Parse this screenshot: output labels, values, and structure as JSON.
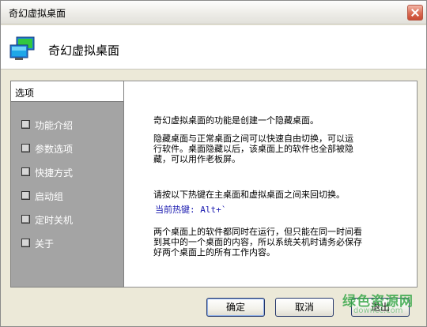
{
  "window": {
    "title": "奇幻虚拟桌面"
  },
  "header": {
    "title": "奇幻虚拟桌面",
    "icon": "two-monitors-icon"
  },
  "sidebar": {
    "heading": "选项",
    "items": [
      {
        "label": "功能介绍"
      },
      {
        "label": "参数选项"
      },
      {
        "label": "快捷方式"
      },
      {
        "label": "启动组"
      },
      {
        "label": "定时关机"
      },
      {
        "label": "关于"
      }
    ]
  },
  "content": {
    "intro": "奇幻虚拟桌面的功能是创建一个隐藏桌面。",
    "desc_lines": [
      "隐藏桌面与正常桌面之间可以快速自由切换，可以运",
      "行软件。桌面隐藏以后，该桌面上的软件也全部被隐",
      "藏，可以用作老板屏。"
    ],
    "hotkey_hint": "请按以下热键在主桌面和虚拟桌面之间来回切换。",
    "hotkey_value": "当前热键: Alt+`",
    "note_lines": [
      "两个桌面上的软件都同时在运行，但只能在同一时间看",
      "到其中的一个桌面的内容，所以系统关机时请务必保存",
      "好两个桌面上的所有工作内容。"
    ]
  },
  "buttons": {
    "ok": "确定",
    "cancel": "取消",
    "exit": "退出"
  },
  "watermark": {
    "text": "绿色资源网",
    "url": "downcc.com"
  },
  "colors": {
    "sidebar_bg": "#a4a4a4",
    "hotkey": "#1b1bb0",
    "watermark": "#39a84a"
  }
}
